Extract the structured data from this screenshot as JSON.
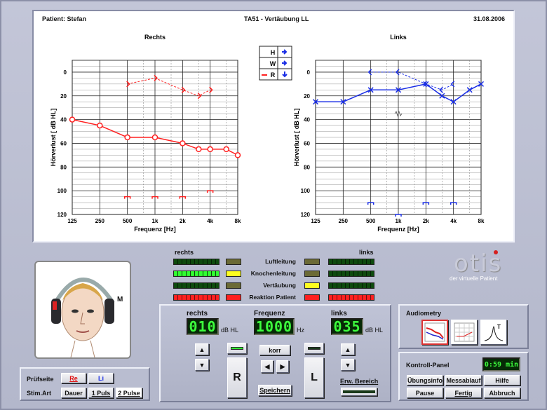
{
  "header": {
    "patient": "Patient: Stefan",
    "test": "TA51 - Vertäubung LL",
    "date": "31.08.2006"
  },
  "audiogram_right": {
    "title": "Rechts",
    "xlabel": "Frequenz [Hz]",
    "ylabel": "Hörverlust [ dB HL]",
    "xticks": [
      "125",
      "250",
      "500",
      "1k",
      "2k",
      "4k",
      "8k"
    ],
    "yticks": [
      "0",
      "20",
      "40",
      "60",
      "80",
      "100",
      "120"
    ],
    "air_conduction": [
      [
        125,
        40
      ],
      [
        250,
        45
      ],
      [
        500,
        55
      ],
      [
        1000,
        55
      ],
      [
        2000,
        60
      ],
      [
        3000,
        65
      ],
      [
        4000,
        65
      ],
      [
        6000,
        65
      ],
      [
        8000,
        70
      ]
    ],
    "bone_conduction": [
      [
        500,
        10
      ],
      [
        1000,
        5
      ],
      [
        2000,
        15
      ],
      [
        3000,
        20
      ],
      [
        4000,
        15
      ]
    ],
    "no_response_marks": [
      [
        500,
        105
      ],
      [
        1000,
        105
      ],
      [
        2000,
        105
      ],
      [
        4000,
        100
      ]
    ],
    "color": "#ff2020"
  },
  "audiogram_left": {
    "title": "Links",
    "xlabel": "Frequenz [Hz]",
    "ylabel": "Hörverlust [ dB HL]",
    "xticks": [
      "125",
      "250",
      "500",
      "1k",
      "2k",
      "4k",
      "8k"
    ],
    "yticks": [
      "0",
      "20",
      "40",
      "60",
      "80",
      "100",
      "120"
    ],
    "air_conduction": [
      [
        125,
        25
      ],
      [
        250,
        25
      ],
      [
        500,
        15
      ],
      [
        1000,
        15
      ],
      [
        2000,
        10
      ],
      [
        3000,
        20
      ],
      [
        4000,
        25
      ],
      [
        6000,
        15
      ],
      [
        8000,
        10
      ]
    ],
    "bone_conduction": [
      [
        500,
        0
      ],
      [
        1000,
        0
      ],
      [
        2000,
        10
      ],
      [
        3000,
        15
      ],
      [
        4000,
        10
      ]
    ],
    "masking_mark": [
      1000,
      35
    ],
    "no_response_marks": [
      [
        500,
        110
      ],
      [
        1000,
        120
      ],
      [
        2000,
        110
      ],
      [
        4000,
        110
      ]
    ],
    "color": "#1a2ee6"
  },
  "legend": {
    "rows": [
      "H",
      "W",
      "R"
    ]
  },
  "indicators": {
    "rechts": "rechts",
    "links": "links",
    "rows": [
      "Luftleitung",
      "Knochenleitung",
      "Vertäubung",
      "Reaktion Patient"
    ],
    "lamps_left": [
      "#6b6a36",
      "#fdfd20",
      "#6b6a36",
      "#ff2020"
    ],
    "lamps_right": [
      "#6b6a36",
      "#6b6a36",
      "#fdfd20",
      "#ff2020"
    ]
  },
  "logo": {
    "name": "otis",
    "tagline": "der virtuelle Patient"
  },
  "control": {
    "rechts": "rechts",
    "frequenz": "Frequenz",
    "links": "links",
    "right_level": "010",
    "freq_value": "1000",
    "left_level": "035",
    "unit_db": "dB HL",
    "unit_hz": "Hz",
    "korr": "korr",
    "speichern": "Speichern",
    "R": "R",
    "L": "L",
    "erw_bereich": "Erw. Bereich"
  },
  "pruefseite": {
    "label": "Prüfseite",
    "re": "Re",
    "li": "Li",
    "stim": "Stim.Art",
    "dauer": "Dauer",
    "puls1": "1 Puls",
    "puls2": "2 Pulse"
  },
  "audiometry": {
    "label": "Audiometry"
  },
  "kontroll": {
    "label": "Kontroll-Panel",
    "timer": "0:59 min",
    "uebungsinfo": "Übungsinfo",
    "messablauf": "Messablauf",
    "hilfe": "Hilfe",
    "pause": "Pause",
    "fertig": "Fertig",
    "abbruch": "Abbruch"
  }
}
